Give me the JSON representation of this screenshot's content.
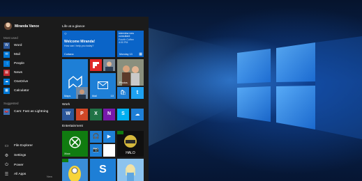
{
  "user": {
    "name": "Miranda Vance"
  },
  "most_used": {
    "label": "Most used",
    "items": [
      {
        "label": "Word",
        "icon": "word-icon",
        "color": "#2b579a"
      },
      {
        "label": "Mail",
        "icon": "mail-icon",
        "color": "#0078d7"
      },
      {
        "label": "People",
        "icon": "people-icon",
        "color": "#0078d7"
      },
      {
        "label": "News",
        "icon": "news-icon",
        "color": "#c1272d"
      },
      {
        "label": "OneDrive",
        "icon": "onedrive-icon",
        "color": "#0078d7"
      },
      {
        "label": "Calculator",
        "icon": "calculator-icon",
        "color": "#0078d7"
      }
    ]
  },
  "suggested": {
    "label": "Suggested",
    "items": [
      {
        "label": "Cars: Fast as Lightning",
        "icon": "cars-game-icon",
        "color": "#3b6fb3"
      }
    ]
  },
  "bottom": {
    "file_explorer": "File Explorer",
    "settings": "Settings",
    "power": "Power",
    "all_apps": "All Apps",
    "new_badge": "New"
  },
  "tiles": {
    "life_group": "Life at a glance",
    "work_group": "Work",
    "ent_group": "Entertainment",
    "cortana": {
      "title": "Welcome Miranda!",
      "subtitle": "How can I help you today?",
      "label": "Cortana"
    },
    "calendar": {
      "line1": "Interview new",
      "line2": "consultant",
      "line3": "Fourth Coffee",
      "line4": "4:00 PM",
      "date": "Monday 13"
    },
    "maps_label": "Maps",
    "photos_label": "Photos",
    "mail": {
      "label": "Mail",
      "count": "10"
    },
    "xbox_label": "Xbox",
    "colors": {
      "accent": "#0078d7",
      "flipboard": "#e12828",
      "xbox": "#107c10",
      "tile_blue": "#1e7fd6"
    }
  }
}
